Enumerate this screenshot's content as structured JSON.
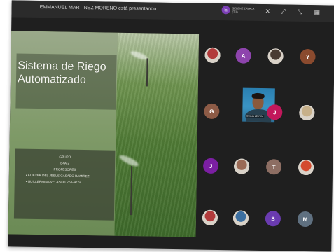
{
  "topbar": {
    "presenter_text": "EMMANUEL MARTINEZ MORENO está presentando",
    "user_initial": "E",
    "user_name_line1": "SELENE ZAVALA",
    "user_name_line2": "(TÚ)"
  },
  "slide": {
    "title": "Sistema de Riego Automatizado",
    "group_label": "GRUPO",
    "group_value": "B4A-2",
    "teachers_label": "PROFESORES",
    "teachers": [
      "•   ELIEZER DEL JESUS CASADO RAMIREZ",
      "•   GUILLERMINA VELASCO VIVEROS"
    ]
  },
  "participants": [
    {
      "initial": "",
      "color": "#b23b3b",
      "kind": "photo"
    },
    {
      "initial": "A",
      "color": "#8e44ad",
      "kind": "letter"
    },
    {
      "initial": "",
      "color": "#4a3b32",
      "kind": "photo"
    },
    {
      "initial": "Y",
      "color": "#8a4a2e",
      "kind": "letter"
    },
    {
      "initial": "G",
      "color": "#8d5b46",
      "kind": "letter"
    },
    {
      "initial": "J",
      "color": "#c2185b",
      "kind": "letter"
    },
    {
      "initial": "",
      "color": "#c7b08a",
      "kind": "photo"
    },
    {
      "initial": "J",
      "color": "#7b1fa2",
      "kind": "letter"
    },
    {
      "initial": "",
      "color": "#9a6a55",
      "kind": "photo"
    },
    {
      "initial": "T",
      "color": "#8d6e63",
      "kind": "letter"
    },
    {
      "initial": "",
      "color": "#d44b2e",
      "kind": "photo"
    },
    {
      "initial": "",
      "color": "#b23b3b",
      "kind": "photo"
    },
    {
      "initial": "",
      "color": "#3c6fa0",
      "kind": "photo"
    },
    {
      "initial": "S",
      "color": "#6a3bb0",
      "kind": "letter"
    },
    {
      "initial": "M",
      "color": "#5f7080",
      "kind": "letter"
    }
  ],
  "video": {
    "name": "DIANA LEYVA"
  }
}
